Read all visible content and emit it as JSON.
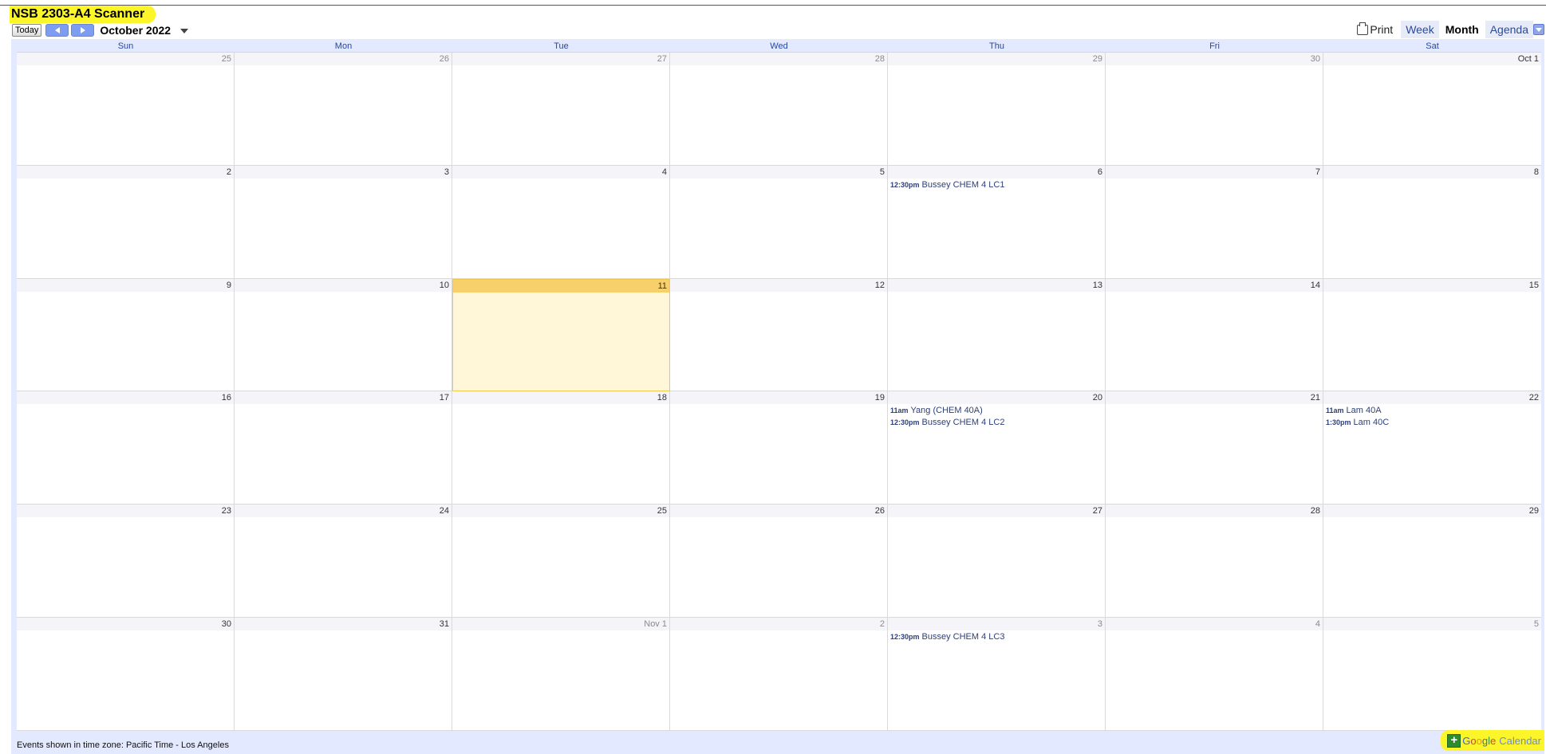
{
  "title": "NSB 2303-A4 Scanner",
  "nav": {
    "today_label": "Today",
    "month_label": "October 2022"
  },
  "views": {
    "print_label": "Print",
    "week_label": "Week",
    "month_label": "Month",
    "agenda_label": "Agenda",
    "active": "Month"
  },
  "weekdays": [
    "Sun",
    "Mon",
    "Tue",
    "Wed",
    "Thu",
    "Fri",
    "Sat"
  ],
  "weeks": [
    [
      {
        "label": "25",
        "other": true
      },
      {
        "label": "26",
        "other": true
      },
      {
        "label": "27",
        "other": true
      },
      {
        "label": "28",
        "other": true
      },
      {
        "label": "29",
        "other": true
      },
      {
        "label": "30",
        "other": true
      },
      {
        "label": "Oct 1"
      }
    ],
    [
      {
        "label": "2"
      },
      {
        "label": "3"
      },
      {
        "label": "4"
      },
      {
        "label": "5"
      },
      {
        "label": "6",
        "events": [
          {
            "time": "12:30pm",
            "title": "Bussey CHEM 4 LC1"
          }
        ]
      },
      {
        "label": "7"
      },
      {
        "label": "8"
      }
    ],
    [
      {
        "label": "9"
      },
      {
        "label": "10"
      },
      {
        "label": "11",
        "today": true
      },
      {
        "label": "12"
      },
      {
        "label": "13"
      },
      {
        "label": "14"
      },
      {
        "label": "15"
      }
    ],
    [
      {
        "label": "16"
      },
      {
        "label": "17"
      },
      {
        "label": "18"
      },
      {
        "label": "19"
      },
      {
        "label": "20",
        "events": [
          {
            "time": "11am",
            "title": "Yang (CHEM 40A)"
          },
          {
            "time": "12:30pm",
            "title": "Bussey CHEM 4 LC2"
          }
        ]
      },
      {
        "label": "21"
      },
      {
        "label": "22",
        "events": [
          {
            "time": "11am",
            "title": "Lam 40A"
          },
          {
            "time": "1:30pm",
            "title": "Lam 40C"
          }
        ]
      }
    ],
    [
      {
        "label": "23"
      },
      {
        "label": "24"
      },
      {
        "label": "25"
      },
      {
        "label": "26"
      },
      {
        "label": "27"
      },
      {
        "label": "28"
      },
      {
        "label": "29"
      }
    ],
    [
      {
        "label": "30"
      },
      {
        "label": "31"
      },
      {
        "label": "Nov 1",
        "other": true
      },
      {
        "label": "2",
        "other": true
      },
      {
        "label": "3",
        "other": true,
        "events": [
          {
            "time": "12:30pm",
            "title": "Bussey CHEM 4 LC3"
          }
        ]
      },
      {
        "label": "4",
        "other": true
      },
      {
        "label": "5",
        "other": true
      }
    ]
  ],
  "footer": {
    "timezone_text": "Events shown in time zone: Pacific Time - Los Angeles",
    "gcal_plus": "+",
    "gcal_google_letters": [
      "G",
      "o",
      "o",
      "g",
      "l",
      "e"
    ],
    "gcal_calendar": "Calendar"
  },
  "colors": {
    "accent_blue": "#2448a8",
    "today_bg": "#fff7d7",
    "today_header": "#f7d06c",
    "highlight_yellow": "#fbf52a",
    "frame_bg": "#e3e9ff"
  }
}
